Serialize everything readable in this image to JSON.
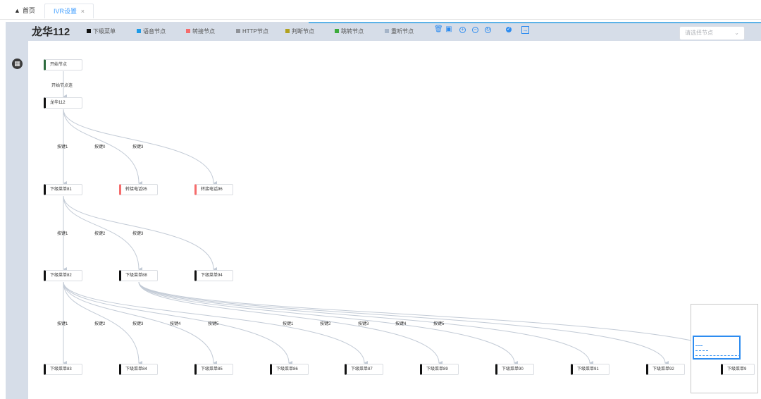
{
  "tabs": {
    "home": "首页",
    "ivr": "IVR设置",
    "close": "×"
  },
  "header": {
    "title": "龙华112"
  },
  "legend": [
    {
      "label": "下级菜单",
      "color": "#111111"
    },
    {
      "label": "语音节点",
      "color": "#1e9be8"
    },
    {
      "label": "转接节点",
      "color": "#f56c6c"
    },
    {
      "label": "HTTP节点",
      "color": "#909399"
    },
    {
      "label": "判断节点",
      "color": "#b1a11f"
    },
    {
      "label": "跳转节点",
      "color": "#3cab3c"
    },
    {
      "label": "重听节点",
      "color": "#a5b4c8"
    }
  ],
  "toolbar_icons": [
    "trash-outline-icon",
    "trash-icon",
    "zoom-in-icon",
    "zoom-out-icon",
    "refresh-icon",
    "check-circle-icon",
    "exit-icon"
  ],
  "select": {
    "placeholder": "请选择节点"
  },
  "nodes": {
    "n_start": {
      "label": "开始节点",
      "color": "#2e6b3e"
    },
    "n_root": {
      "label": "龙华112",
      "color": "#111111"
    },
    "n_81": {
      "label": "下级菜单81",
      "color": "#111111"
    },
    "n_95": {
      "label": "转接电话95",
      "color": "#f56c6c"
    },
    "n_96": {
      "label": "转接电话96",
      "color": "#f56c6c"
    },
    "n_82": {
      "label": "下级菜单82",
      "color": "#111111"
    },
    "n_88": {
      "label": "下级菜单88",
      "color": "#111111"
    },
    "n_94": {
      "label": "下级菜单94",
      "color": "#111111"
    },
    "n_83": {
      "label": "下级菜单83",
      "color": "#111111"
    },
    "n_84": {
      "label": "下级菜单84",
      "color": "#111111"
    },
    "n_85": {
      "label": "下级菜单85",
      "color": "#111111"
    },
    "n_86": {
      "label": "下级菜单86",
      "color": "#111111"
    },
    "n_87": {
      "label": "下级菜单87",
      "color": "#111111"
    },
    "n_89": {
      "label": "下级菜单89",
      "color": "#111111"
    },
    "n_90": {
      "label": "下级菜单90",
      "color": "#111111"
    },
    "n_91": {
      "label": "下级菜单91",
      "color": "#111111"
    },
    "n_92": {
      "label": "下级菜单92",
      "color": "#111111"
    },
    "n_93": {
      "label": "下级菜单9",
      "color": "#111111"
    }
  },
  "edge_labels": {
    "e_start": "开始节点连",
    "e_r1": "按键1",
    "e_r0": "按键0",
    "e_r3": "按键3",
    "e_a1": "按键1",
    "e_a2": "按键2",
    "e_a3": "按键3",
    "e_b1": "按键1",
    "e_b2": "按键2",
    "e_b3": "按键3",
    "e_b4": "按键4",
    "e_b5": "按键5",
    "e_c1": "按键1",
    "e_c2": "按键2",
    "e_c3": "按键3",
    "e_c4": "按键4",
    "e_c5": "按键5"
  }
}
